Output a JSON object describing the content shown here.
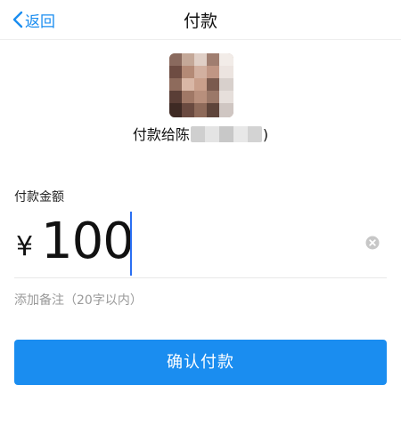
{
  "navbar": {
    "back_label": "返回",
    "title": "付款"
  },
  "payee": {
    "prefix": "付款给陈",
    "suffix": ")"
  },
  "amount": {
    "label": "付款金额",
    "currency": "¥",
    "value": "100"
  },
  "note": {
    "placeholder": "添加备注（20字以内）"
  },
  "confirm_button": {
    "label": "确认付款"
  },
  "colors": {
    "accent": "#1a8df0",
    "caret": "#2a6ff2"
  }
}
